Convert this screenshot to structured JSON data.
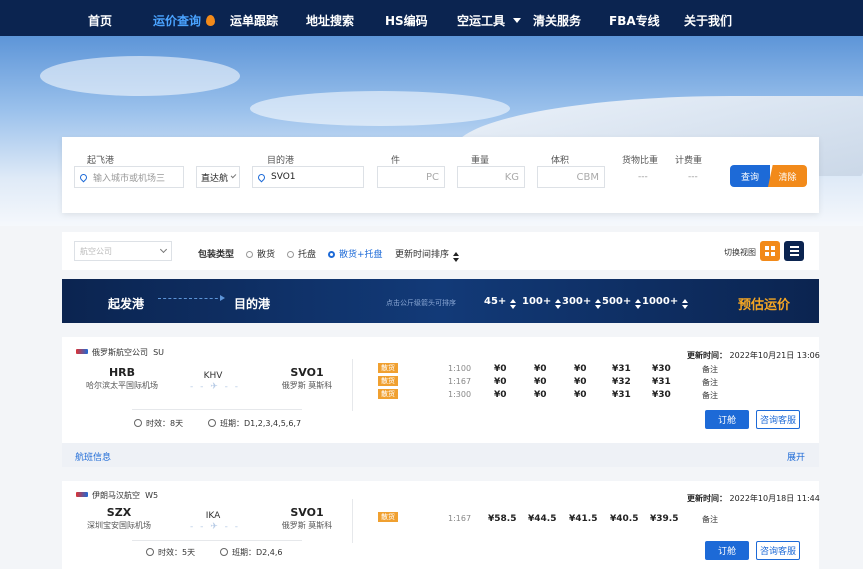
{
  "nav": {
    "items": [
      "首页",
      "运价查询",
      "运单跟踪",
      "地址搜索",
      "HS编码",
      "空运工具",
      "清关服务",
      "FBA专线",
      "关于我们"
    ],
    "active_index": 1
  },
  "search": {
    "origin_label": "起飞港",
    "origin_placeholder": "输入城市或机场三",
    "mode_value": "直达航",
    "dest_label": "目的港",
    "dest_value": "SVO1",
    "pieces_label": "件",
    "pieces_unit": "PC",
    "weight_label": "重量",
    "weight_unit": "KG",
    "volume_label": "体积",
    "volume_unit": "CBM",
    "ratio_label": "货物比重",
    "ratio_value": "---",
    "chargeable_label": "计费重",
    "chargeable_value": "---",
    "query_button": "查询",
    "clear_button": "清除"
  },
  "filter": {
    "airline_placeholder": "航空公司",
    "package_type_label": "包装类型",
    "options": [
      "散货",
      "托盘",
      "散货+托盘"
    ],
    "selected_index": 2,
    "sort_label": "更新时间排序",
    "view_switch_label": "切换视图"
  },
  "header_bar": {
    "origin": "起发港",
    "dest": "目的港",
    "hint": "点击公斤级箭头可排序",
    "weight_breaks": [
      "45+",
      "100+",
      "300+",
      "500+",
      "1000+"
    ],
    "promo": "预估运价"
  },
  "cards": [
    {
      "airline": "俄罗斯航空公司",
      "airline_code": "SU",
      "origin_code": "HRB",
      "origin_name": "哈尔滨太平国际机场",
      "transit": "KHV",
      "dest_code": "SVO1",
      "dest_name": "俄罗斯 莫斯科",
      "duration_label": "时效：",
      "duration": "8天",
      "schedule_label": "班期：",
      "schedule": "D1,2,3,4,5,6,7",
      "update_label": "更新时间：",
      "update_time": "2022年10月21日 13:06",
      "rows": [
        {
          "tag": "散货",
          "ratio": "1:100",
          "prices": [
            "¥0",
            "¥0",
            "¥0",
            "¥31",
            "¥30"
          ],
          "remark": "备注"
        },
        {
          "tag": "散货",
          "ratio": "1:167",
          "prices": [
            "¥0",
            "¥0",
            "¥0",
            "¥32",
            "¥31"
          ],
          "remark": "备注"
        },
        {
          "tag": "散货",
          "ratio": "1:300",
          "prices": [
            "¥0",
            "¥0",
            "¥0",
            "¥31",
            "¥30"
          ],
          "remark": "备注"
        }
      ],
      "book_button": "订舱",
      "service_button": "咨询客服"
    },
    {
      "airline": "伊朗马汉航空",
      "airline_code": "W5",
      "origin_code": "SZX",
      "origin_name": "深圳宝安国际机场",
      "transit": "IKA",
      "dest_code": "SVO1",
      "dest_name": "俄罗斯 莫斯科",
      "duration_label": "时效：",
      "duration": "5天",
      "schedule_label": "班期：",
      "schedule": "D2,4,6",
      "update_label": "更新时间：",
      "update_time": "2022年10月18日 11:44",
      "rows": [
        {
          "tag": "散货",
          "ratio": "1:167",
          "prices": [
            "¥58.5",
            "¥44.5",
            "¥41.5",
            "¥40.5",
            "¥39.5"
          ],
          "remark": "备注"
        }
      ],
      "book_button": "订舱",
      "service_button": "咨询客服"
    }
  ],
  "strip": {
    "left": "航班信息",
    "right": "展开"
  }
}
